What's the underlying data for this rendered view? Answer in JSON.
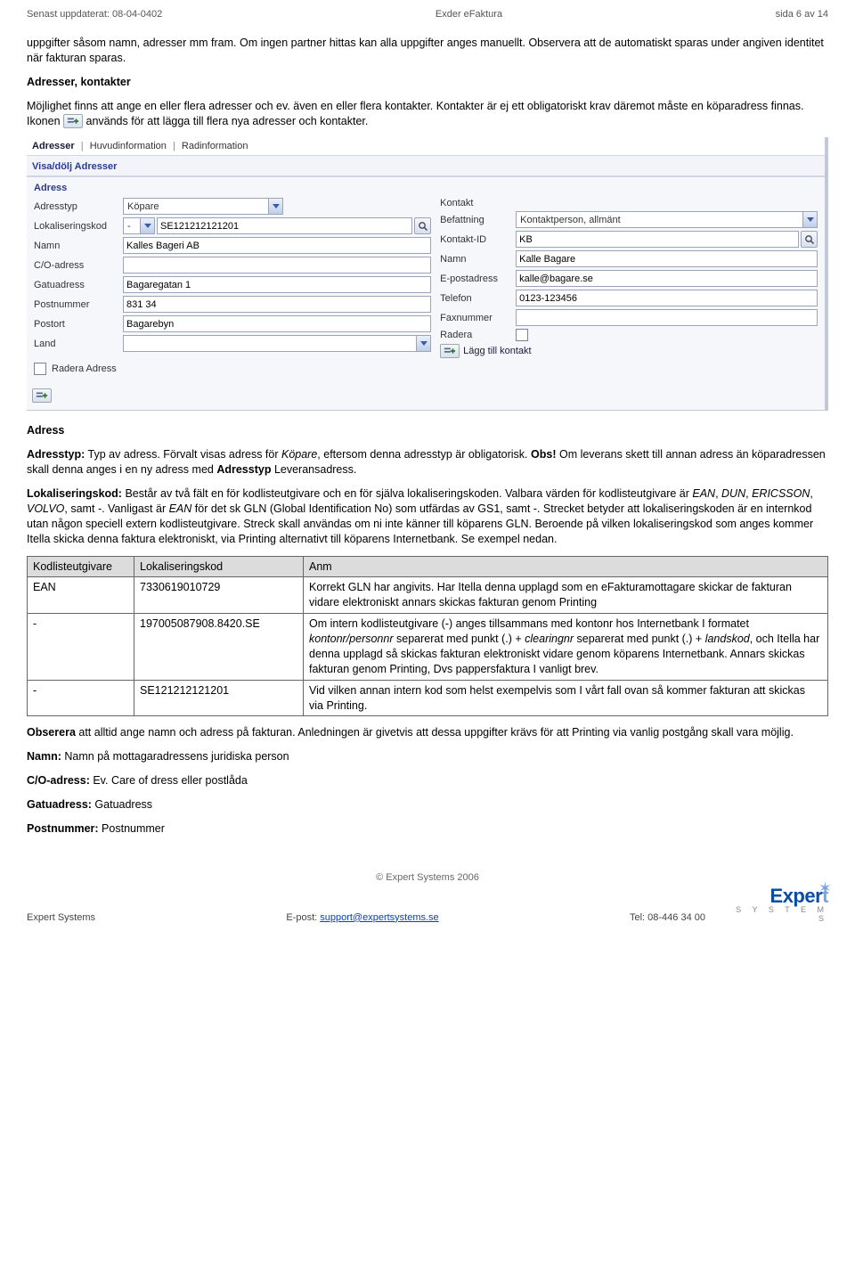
{
  "header": {
    "left": "Senast uppdaterat: 08-04-0402",
    "center": "Exder eFaktura",
    "right": "sida 6 av 14"
  },
  "intro": {
    "p1": "uppgifter såsom namn, adresser mm fram. Om ingen partner hittas kan alla uppgifter anges manuellt. Observera att de automatiskt sparas under angiven identitet när fakturan sparas."
  },
  "adresser": {
    "heading": "Adresser, kontakter",
    "p1a": "Möjlighet finns att ange en eller flera adresser och ev. även en eller flera kontakter. Kontakter är ej ett obligatoriskt krav däremot måste en köparadress finnas. Ikonen ",
    "p1b": " används för att lägga till flera nya adresser och kontakter."
  },
  "screenshot": {
    "tabs": {
      "t1": "Adresser",
      "t2": "Huvudinformation",
      "t3": "Radinformation"
    },
    "visa_line": "Visa/dölj Adresser",
    "left_title": "Adress",
    "right_title_blank": "",
    "left": {
      "adresstyp_label": "Adresstyp",
      "adresstyp_value": "Köpare",
      "lokkod_label": "Lokaliseringskod",
      "lokkod_sel": "-",
      "lokkod_value": "SE121212121201",
      "namn_label": "Namn",
      "namn_value": "Kalles Bageri AB",
      "co_label": "C/O-adress",
      "co_value": "",
      "gatu_label": "Gatuadress",
      "gatu_value": "Bagaregatan 1",
      "postnr_label": "Postnummer",
      "postnr_value": "831 34",
      "postort_label": "Postort",
      "postort_value": "Bagarebyn",
      "land_label": "Land",
      "land_value": "",
      "radera_adress": "Radera Adress"
    },
    "right": {
      "kontakt_label": "Kontakt",
      "befattning_label": "Befattning",
      "befattning_value": "Kontaktperson, allmänt",
      "kontaktid_label": "Kontakt-ID",
      "kontaktid_value": "KB",
      "namn_label": "Namn",
      "namn_value": "Kalle Bagare",
      "epost_label": "E-postadress",
      "epost_value": "kalle@bagare.se",
      "telefon_label": "Telefon",
      "telefon_value": "0123-123456",
      "fax_label": "Faxnummer",
      "fax_value": "",
      "radera_label": "Radera",
      "add_contact": "Lägg till kontakt"
    }
  },
  "adress_section": {
    "heading": "Adress",
    "adresstyp_bold": "Adresstyp:",
    "adresstyp_text_a": " Typ av adress. Förvalt visas adress för ",
    "adresstyp_italic": "Köpare",
    "adresstyp_text_b": ", eftersom denna adresstyp är obligatorisk. ",
    "obs": "Obs!",
    "adresstyp_text_c": " Om leverans skett till annan adress än köparadressen skall denna anges i en ny adress med ",
    "adresstyp_bold2": "Adresstyp",
    "adresstyp_text_d": " Leveransadress.",
    "lok_bold": "Lokaliseringskod:",
    "lok_text_a": " Består av två fält en för kodlisteutgivare och en för själva lokaliseringskoden. Valbara värden för kodlisteutgivare är ",
    "lok_i1": "EAN",
    "lok_c1": ", ",
    "lok_i2": "DUN",
    "lok_c2": ", ",
    "lok_i3": "ERICSSON",
    "lok_c3": ", ",
    "lok_i4": "VOLVO",
    "lok_c4": ", samt ",
    "lok_i5": "-",
    "lok_c5": ". Vanligast är ",
    "lok_i6": "EAN",
    "lok_text_b": " för det sk GLN (Global Identification No) som utfärdas av GS1, samt -. Strecket betyder att lokaliseringskoden är en internkod utan någon speciell extern kodlisteutgivare. Streck skall användas om ni inte känner till köparens GLN. Beroende på vilken lokaliseringskod som anges kommer Itella skicka denna faktura elektroniskt, via Printing alternativt till köparens Internetbank. Se exempel nedan."
  },
  "table": {
    "h1": "Kodlisteutgivare",
    "h2": "Lokaliseringskod",
    "h3": "Anm",
    "r1c1": "EAN",
    "r1c2": "7330619010729",
    "r1c3": "Korrekt GLN har angivits. Har Itella denna upplagd som en eFakturamottagare skickar de fakturan vidare elektroniskt annars skickas fakturan genom Printing",
    "r2c1": "-",
    "r2c2": "197005087908.8420.SE",
    "r2c3a": "Om intern kodlisteutgivare (-) anges tillsammans med kontonr hos Internetbank I formatet ",
    "r2c3_italic1": "kontonr/personnr",
    "r2c3b": " separerat med punkt (.) + ",
    "r2c3_italic2": "clearingnr",
    "r2c3c": " separerat med punkt (.) + ",
    "r2c3_italic3": "landskod",
    "r2c3d": ", och Itella har denna upplagd så skickas fakturan elektroniskt vidare genom köparens Internetbank. Annars skickas fakturan genom Printing, Dvs pappersfaktura I vanligt brev.",
    "r3c1": "-",
    "r3c2": "SE121212121201",
    "r3c3": "Vid vilken annan intern kod som helst exempelvis som I vårt fall ovan så kommer fakturan att skickas via Printing."
  },
  "after_table": {
    "obserera_bold": "Obserera",
    "obserera_text": " att alltid ange namn och adress på fakturan. Anledningen är givetvis att dessa uppgifter krävs för att Printing via vanlig postgång skall vara möjlig.",
    "namn_bold": "Namn:",
    "namn_text": " Namn på mottagaradressens juridiska person",
    "co_bold": "C/O-adress:",
    "co_text": " Ev. Care of dress eller postlåda",
    "gatu_bold": "Gatuadress:",
    "gatu_text": " Gatuadress",
    "post_bold": "Postnummer:",
    "post_text": " Postnummer"
  },
  "footer": {
    "copyright": "© Expert Systems 2006",
    "left": "Expert Systems",
    "center_prefix": "E-post: ",
    "center_link": "support@expertsystems.se",
    "right": "Tel: 08-446 34 00",
    "logo_main": "Exper",
    "logo_accent": "t",
    "logo_sub": "S Y S T E M S"
  }
}
